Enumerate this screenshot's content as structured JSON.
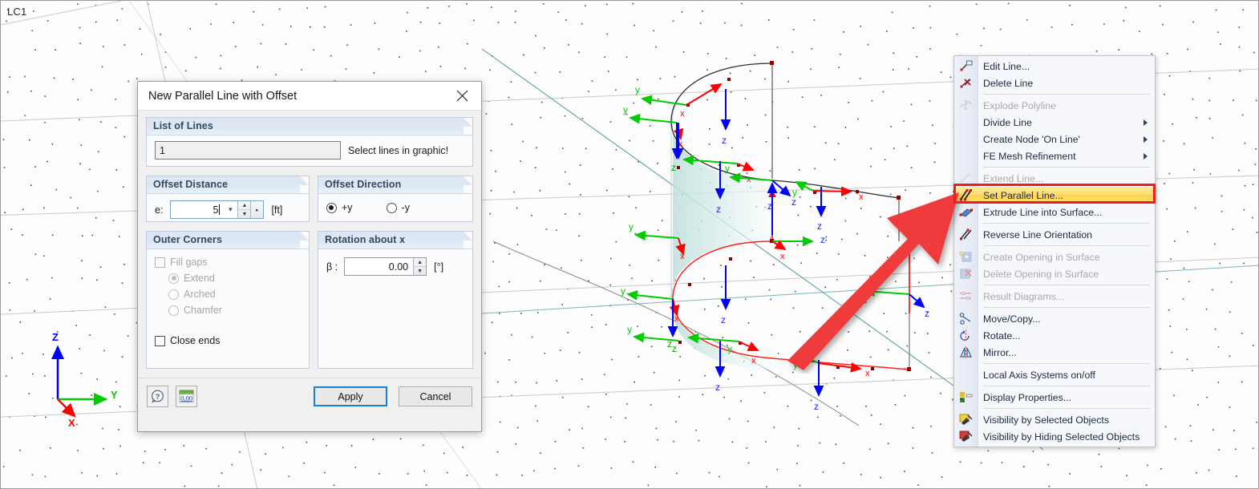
{
  "viewport": {
    "load_case_label": "LC1",
    "axis_indicator": {
      "x": "X",
      "y": "Y",
      "z": "Z"
    },
    "member_axis_labels": {
      "x": "x",
      "y": "y",
      "z": "z"
    },
    "colors": {
      "local_x": "#ff0000",
      "local_y": "#00cc00",
      "local_z": "#0000ff",
      "selected_line": "#ff2020",
      "surface_fill": "#cfe9e6",
      "grid_line": "#c9c9c9",
      "teal_line": "#2f8f8f",
      "annotation_arrow": "#ef3b3b"
    }
  },
  "dialog": {
    "title": "New Parallel Line with Offset",
    "close_icon": "close-icon",
    "list_of_lines": {
      "legend": "List of Lines",
      "value": "1",
      "placeholder": "",
      "hint": "Select lines in graphic!"
    },
    "offset_distance": {
      "legend": "Offset Distance",
      "label": "e:",
      "value": "5",
      "unit": "[ft]"
    },
    "offset_direction": {
      "legend": "Offset Direction",
      "options": [
        {
          "label": "+y",
          "selected": true
        },
        {
          "label": "-y",
          "selected": false
        }
      ]
    },
    "outer_corners": {
      "legend": "Outer Corners",
      "fill_gaps": {
        "label": "Fill gaps",
        "checked": false,
        "enabled": false
      },
      "corner_options": [
        {
          "label": "Extend",
          "selected": true,
          "enabled": false
        },
        {
          "label": "Arched",
          "selected": false,
          "enabled": false
        },
        {
          "label": "Chamfer",
          "selected": false,
          "enabled": false
        }
      ],
      "close_ends": {
        "label": "Close ends",
        "checked": false,
        "enabled": true
      }
    },
    "rotation": {
      "legend": "Rotation about x",
      "label": "β :",
      "value": "0.00",
      "unit": "[°]"
    },
    "footer": {
      "help_icon": "help-question-icon",
      "units_icon": "units-format-icon",
      "apply_label": "Apply",
      "cancel_label": "Cancel"
    }
  },
  "context_menu": {
    "items": [
      {
        "label": "Edit Line...",
        "icon": "edit-line-icon",
        "enabled": true,
        "submenu": false,
        "highlight": false
      },
      {
        "label": "Delete Line",
        "icon": "delete-line-icon",
        "enabled": true,
        "submenu": false,
        "highlight": false
      },
      {
        "separator": true
      },
      {
        "label": "Explode Polyline",
        "icon": "explode-polyline-icon",
        "enabled": false,
        "submenu": false,
        "highlight": false
      },
      {
        "label": "Divide Line",
        "icon": "",
        "enabled": true,
        "submenu": true,
        "highlight": false
      },
      {
        "label": "Create Node 'On Line'",
        "icon": "",
        "enabled": true,
        "submenu": true,
        "highlight": false
      },
      {
        "label": "FE Mesh Refinement",
        "icon": "",
        "enabled": true,
        "submenu": true,
        "highlight": false
      },
      {
        "separator": true
      },
      {
        "label": "Extend Line...",
        "icon": "extend-line-icon",
        "enabled": false,
        "submenu": false,
        "highlight": false
      },
      {
        "label": "Set Parallel Line...",
        "icon": "set-parallel-line-icon",
        "enabled": true,
        "submenu": false,
        "highlight": true
      },
      {
        "label": "Extrude Line into Surface...",
        "icon": "extrude-line-icon",
        "enabled": true,
        "submenu": false,
        "highlight": false
      },
      {
        "separator": true
      },
      {
        "label": "Reverse Line Orientation",
        "icon": "reverse-orientation-icon",
        "enabled": true,
        "submenu": false,
        "highlight": false
      },
      {
        "separator": true
      },
      {
        "label": "Create Opening in Surface",
        "icon": "create-opening-icon",
        "enabled": false,
        "submenu": false,
        "highlight": false
      },
      {
        "label": "Delete Opening in Surface",
        "icon": "delete-opening-icon",
        "enabled": false,
        "submenu": false,
        "highlight": false
      },
      {
        "separator": true
      },
      {
        "label": "Result Diagrams...",
        "icon": "result-diagrams-icon",
        "enabled": false,
        "submenu": false,
        "highlight": false
      },
      {
        "separator": true
      },
      {
        "label": "Move/Copy...",
        "icon": "move-copy-icon",
        "enabled": true,
        "submenu": false,
        "highlight": false
      },
      {
        "label": "Rotate...",
        "icon": "rotate-icon",
        "enabled": true,
        "submenu": false,
        "highlight": false
      },
      {
        "label": "Mirror...",
        "icon": "mirror-icon",
        "enabled": true,
        "submenu": false,
        "highlight": false
      },
      {
        "separator": true
      },
      {
        "label": "Local Axis Systems on/off",
        "icon": "",
        "enabled": true,
        "submenu": false,
        "highlight": false
      },
      {
        "separator": true
      },
      {
        "label": "Display Properties...",
        "icon": "display-properties-icon",
        "enabled": true,
        "submenu": false,
        "highlight": false
      },
      {
        "separator": true
      },
      {
        "label": "Visibility by Selected Objects",
        "icon": "visibility-selected-icon",
        "enabled": true,
        "submenu": false,
        "highlight": false
      },
      {
        "label": "Visibility by Hiding Selected Objects",
        "icon": "visibility-hiding-icon",
        "enabled": true,
        "submenu": false,
        "highlight": false
      }
    ]
  }
}
